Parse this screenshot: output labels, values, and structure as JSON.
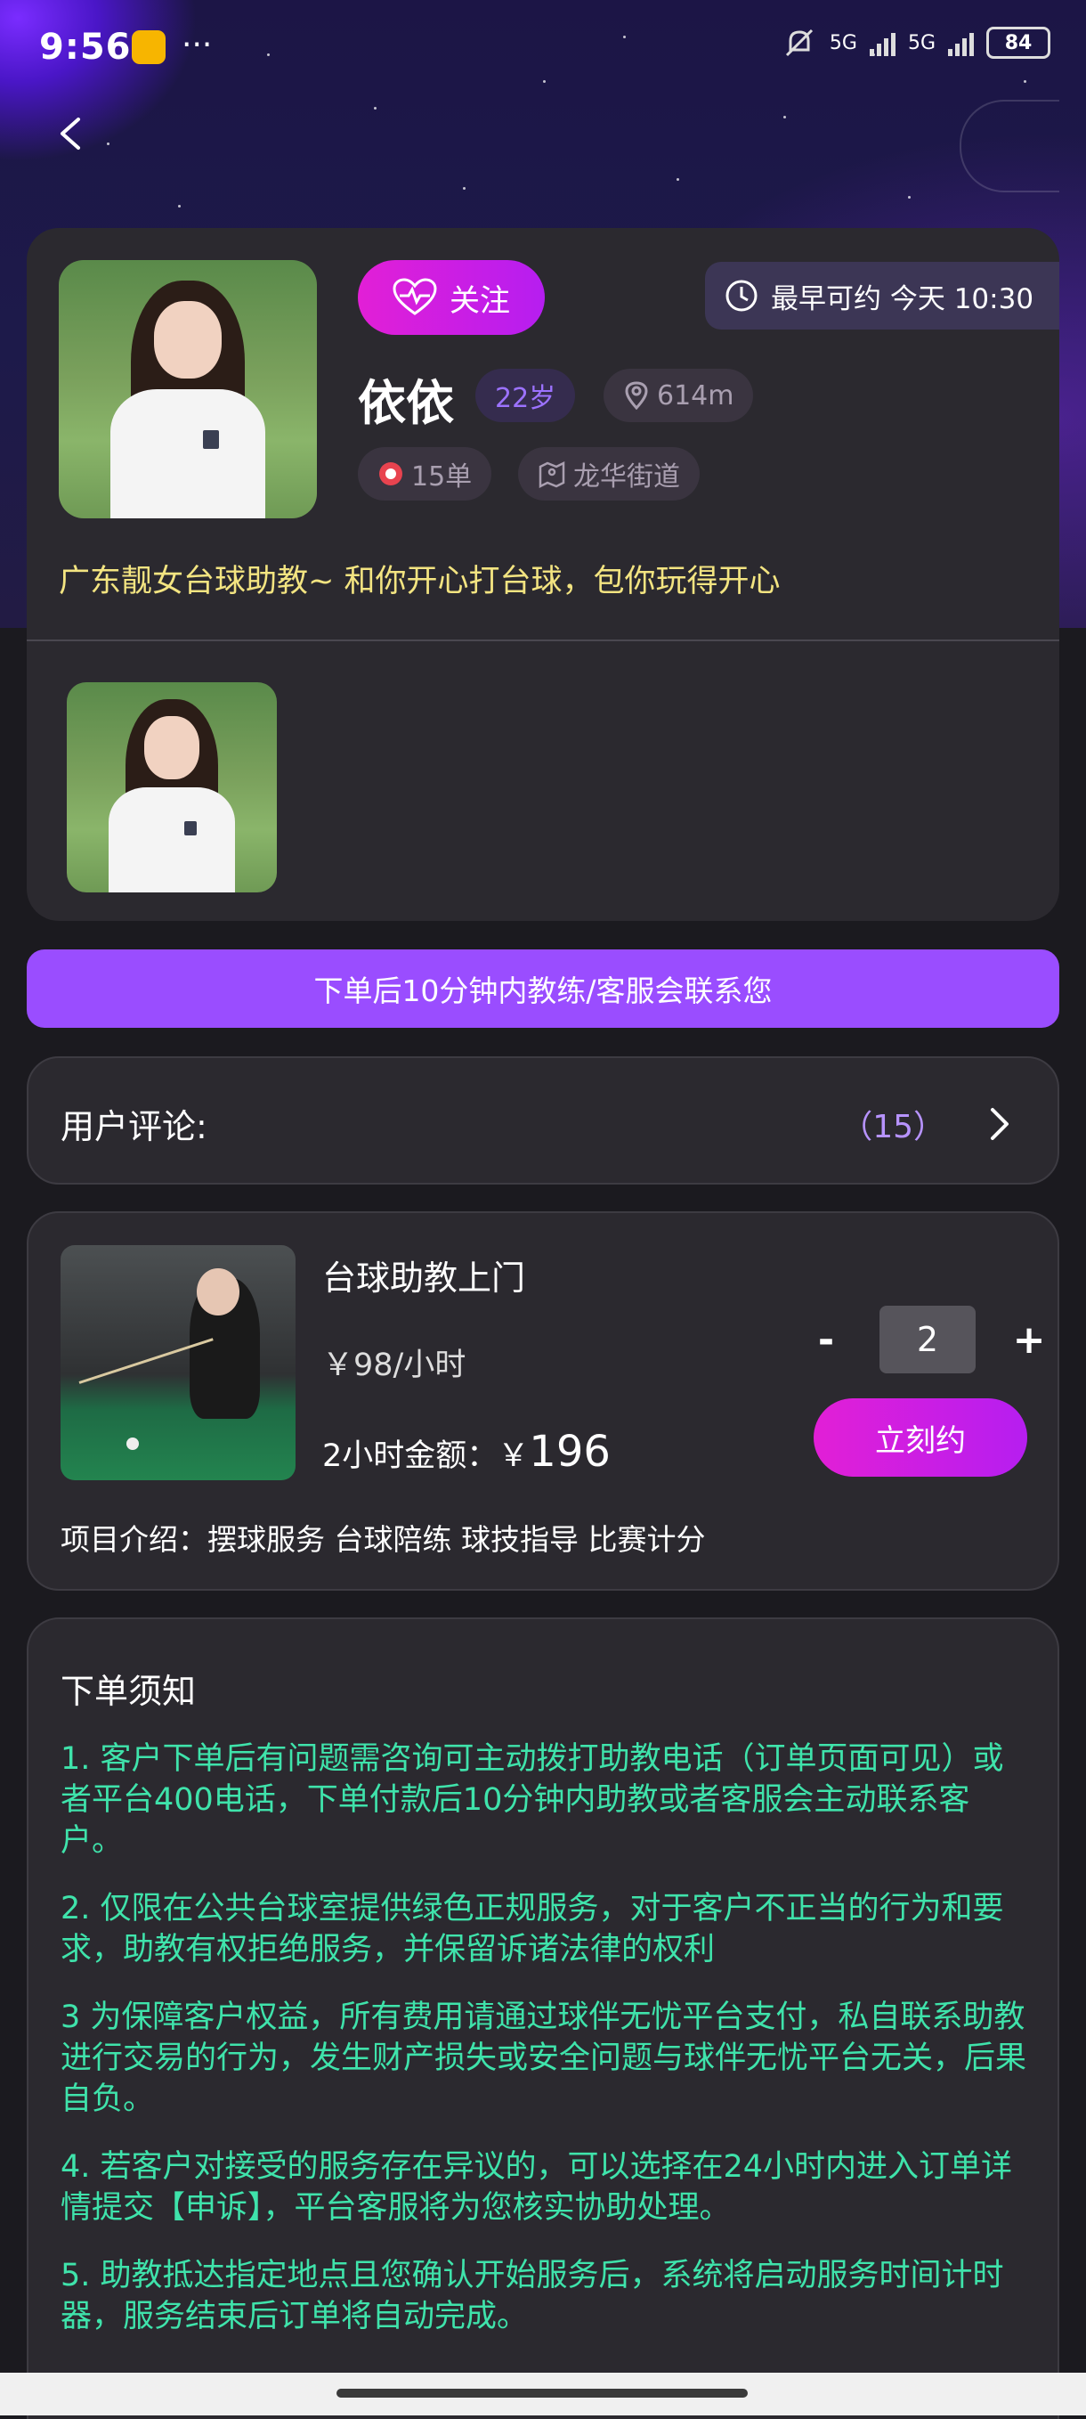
{
  "status_bar": {
    "time": "9:56",
    "dots": "···",
    "net1": "5G",
    "net2": "5G",
    "battery": "84"
  },
  "profile": {
    "follow_label": "关注",
    "earliest": "最早可约 今天 10:30",
    "name": "依依",
    "age": "22岁",
    "distance": "614m",
    "orders": "15单",
    "area": "龙华街道",
    "slogan": "广东靓女台球助教~ 和你开心打台球，包你玩得开心"
  },
  "notice": "下单后10分钟内教练/客服会联系您",
  "reviews": {
    "label": "用户评论:",
    "count": "（15）"
  },
  "service": {
    "title": "台球助教上门",
    "price": "￥98/小时",
    "total_label": "2小时金额：￥",
    "total_value": "196",
    "minus": "-",
    "quantity": "2",
    "plus": "+",
    "book_label": "立刻约",
    "description": "项目介绍：摆球服务 台球陪练 球技指导 比赛计分"
  },
  "rules": {
    "title": "下单须知",
    "items": [
      "1. 客户下单后有问题需咨询可主动拨打助教电话（订单页面可见）或者平台400电话，下单付款后10分钟内助教或者客服会主动联系客户。",
      "2. 仅限在公共台球室提供绿色正规服务，对于客户不正当的行为和要求，助教有权拒绝服务，并保留诉诸法律的权利",
      "3 为保障客户权益，所有费用请通过球伴无忧平台支付，私自联系助教进行交易的行为，发生财产损失或安全问题与球伴无忧平台无关，后果自负。",
      "4. 若客户对接受的服务存在异议的，可以选择在24小时内进入订单详情提交【申诉】，平台客服将为您核实协助处理。",
      "5. 助教抵达指定地点且您确认开始服务后，系统将启动服务时间计时器，服务结束后订单将自动完成。"
    ]
  },
  "colors": {
    "accent_gradient_start": "#e21fd6",
    "accent_gradient_end": "#b61ef0",
    "notice_bg": "#9a4dff",
    "slogan": "#f3e481",
    "rules_text": "#3fe3ab"
  }
}
